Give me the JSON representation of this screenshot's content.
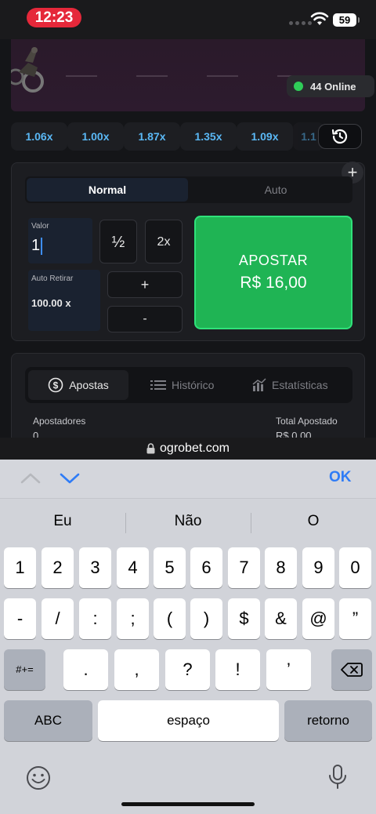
{
  "status": {
    "time": "12:23",
    "battery": "59"
  },
  "game": {
    "online_text": "44 Online"
  },
  "multipliers": [
    "1.06x",
    "1.00x",
    "1.87x",
    "1.35x",
    "1.09x",
    "1.1"
  ],
  "bet": {
    "tab_normal": "Normal",
    "tab_auto": "Auto",
    "value_label": "Valor",
    "value": "1",
    "half_label": "½",
    "double_label": "2x",
    "autowithdraw_label": "Auto Retirar",
    "autowithdraw_value": "100.00 x",
    "plus_label": "+",
    "minus_label": "-",
    "apostar_label": "APOSTAR",
    "apostar_amount": "R$ 16,00",
    "add_label": "+"
  },
  "bets": {
    "tab_bets": "Apostas",
    "tab_history": "Histórico",
    "tab_stats": "Estatísticas",
    "players_label": "Apostadores",
    "players_value": "0",
    "total_label": "Total Apostado",
    "total_value": "R$ 0,00"
  },
  "browser": {
    "url": "ogrobet.com"
  },
  "keyboard": {
    "ok_label": "OK",
    "suggestions": [
      "Eu",
      "Não",
      "O"
    ],
    "row1": [
      "1",
      "2",
      "3",
      "4",
      "5",
      "6",
      "7",
      "8",
      "9",
      "0"
    ],
    "row2": [
      "-",
      "/",
      ":",
      ";",
      "(",
      ")",
      "$",
      "&",
      "@",
      "”"
    ],
    "row3": [
      ".",
      ",",
      "?",
      "!",
      "’"
    ],
    "symbols_label": "#+=",
    "abc_label": "ABC",
    "space_label": "espaço",
    "return_label": "retorno"
  },
  "colors": {
    "accent_green": "#1fb454",
    "multiplier_blue": "#5ab8f5",
    "ios_blue": "#2f7cf6",
    "online_green": "#2fcd58"
  }
}
